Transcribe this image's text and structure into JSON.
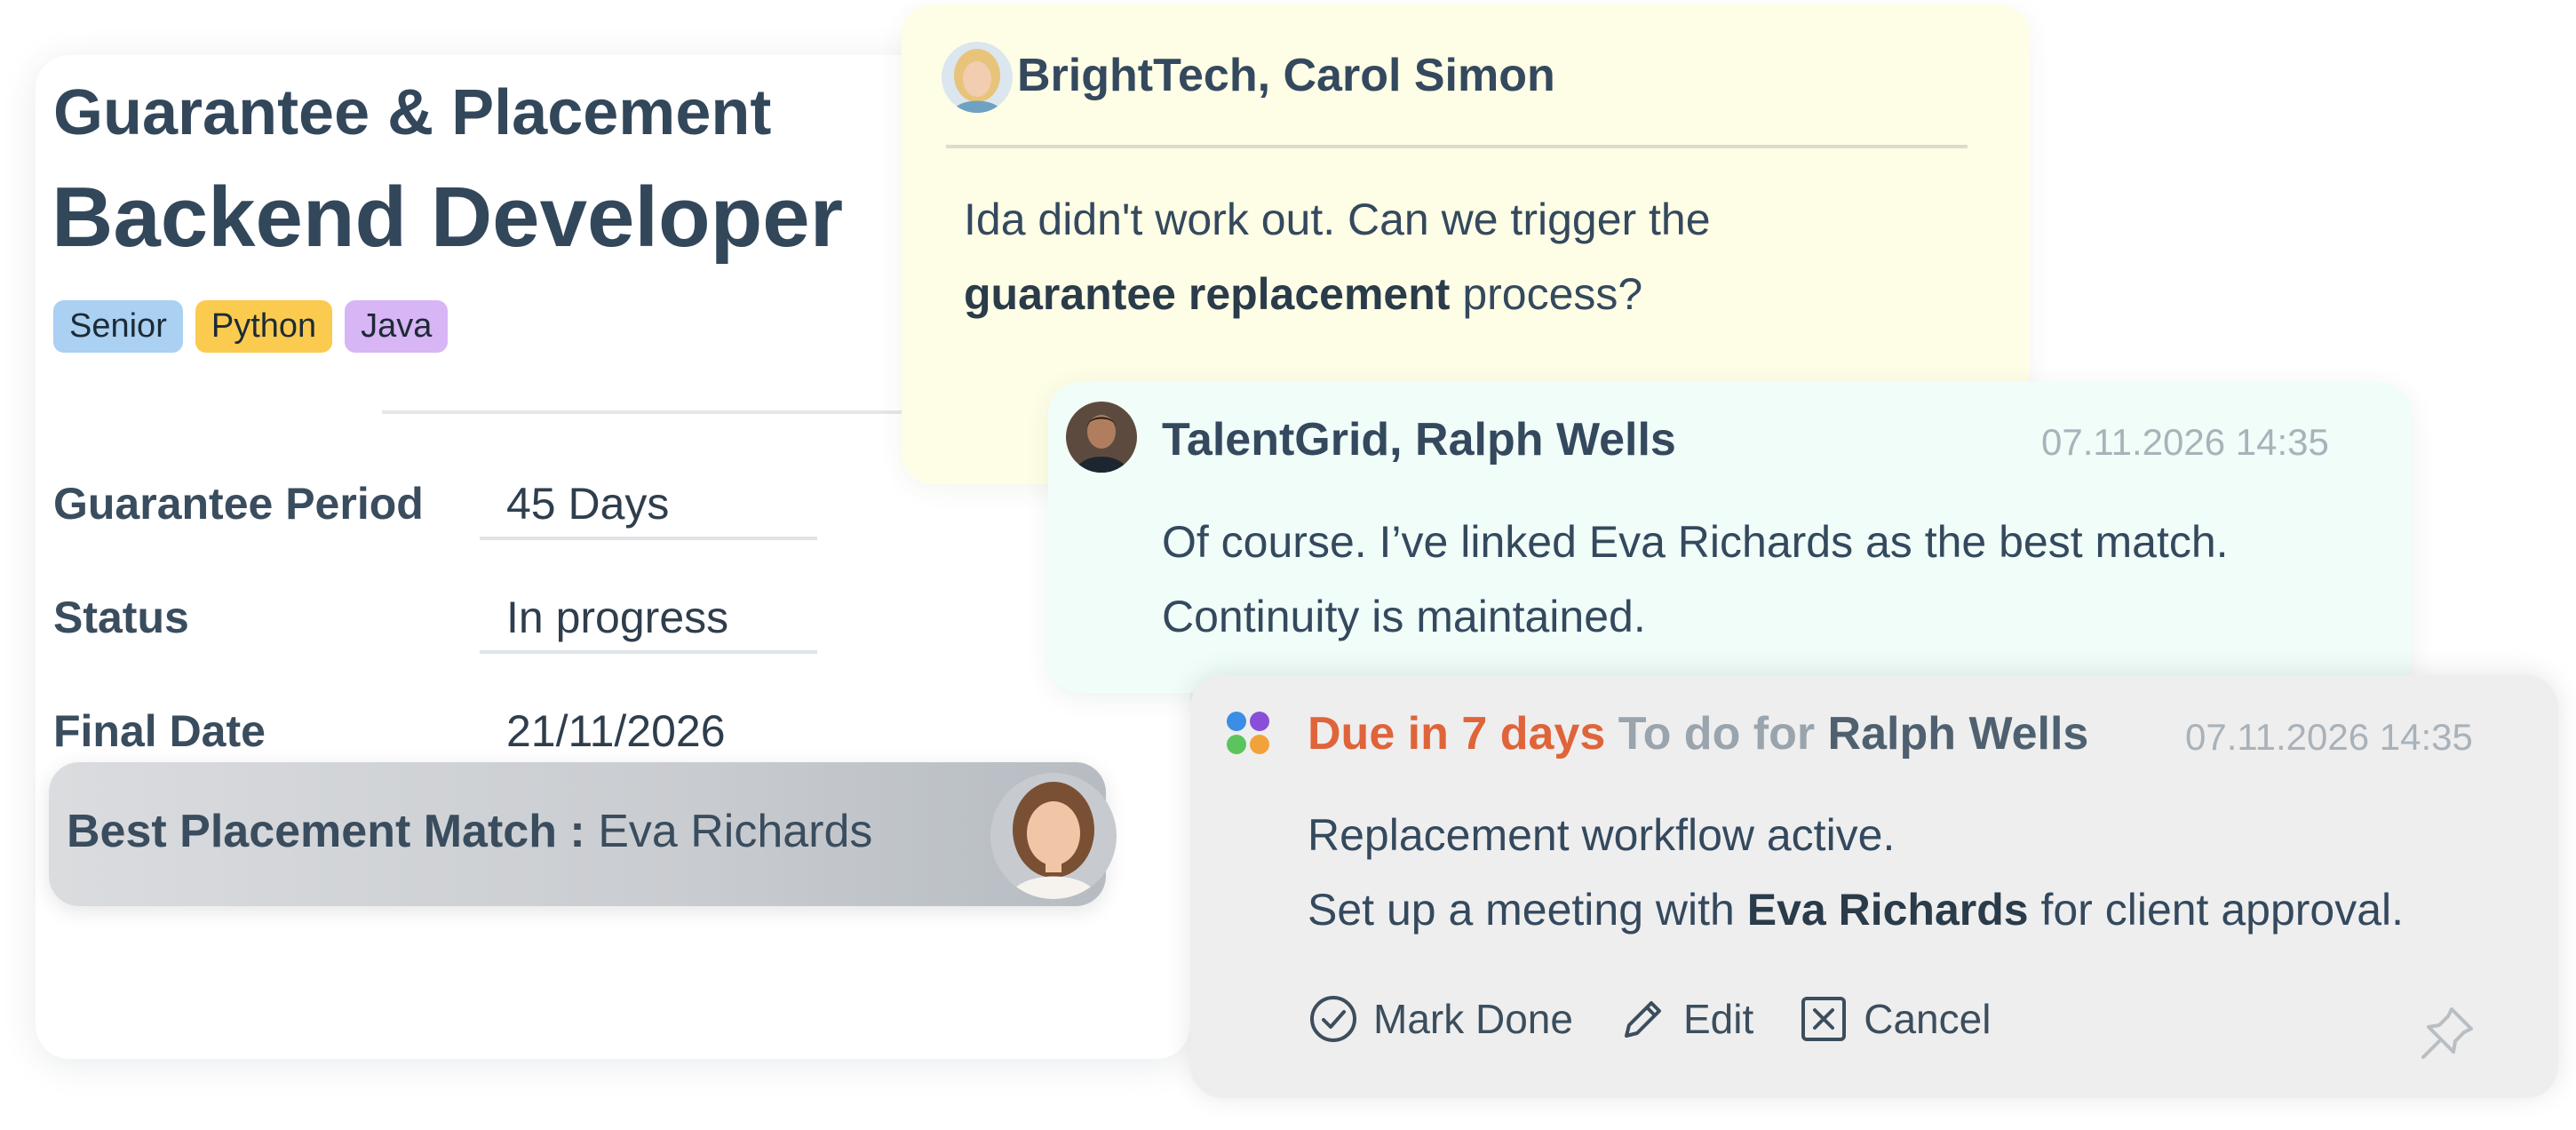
{
  "main_card": {
    "title": "Guarantee & Placement",
    "role": "Backend Developer",
    "tags": [
      "Senior",
      "Python",
      "Java"
    ],
    "fields": [
      {
        "label": "Guarantee Period",
        "value": "45 Days"
      },
      {
        "label": "Status",
        "value": "In progress"
      },
      {
        "label": "Final Date",
        "value": "21/11/2026"
      }
    ],
    "match": {
      "label": "Best Placement Match :",
      "name": "Eva Richards"
    }
  },
  "message1": {
    "sender": "BrightTech, Carol Simon",
    "text_part1": "Ida didn't work out. Can we trigger the",
    "text_bold": "guarantee replacement",
    "text_part2": "process?"
  },
  "message2": {
    "sender": "TalentGrid, Ralph Wells",
    "timestamp": "07.11.2026 14:35",
    "line1": "Of course. I’ve linked Eva Richards as the best match.",
    "line2": "Continuity is maintained."
  },
  "task": {
    "due": "Due in 7 days",
    "todo_label": "To do for",
    "assignee": "Ralph Wells",
    "timestamp": "07.11.2026 14:35",
    "line1": "Replacement workflow active.",
    "line2_part1": "Set up a meeting with",
    "line2_bold": "Eva Richards",
    "line2_part2": "for client approval.",
    "actions": {
      "done": "Mark Done",
      "edit": "Edit",
      "cancel": "Cancel"
    }
  },
  "colors": {
    "accent_due": "#e0643a",
    "text_dark": "#34495e",
    "message1_bg": "#fefee6",
    "message2_bg": "#f0fdf8",
    "task_bg": "#eeeeee"
  },
  "icons": [
    "check-circle-icon",
    "pencil-icon",
    "x-square-icon",
    "pin-icon",
    "app-logo-icon"
  ]
}
